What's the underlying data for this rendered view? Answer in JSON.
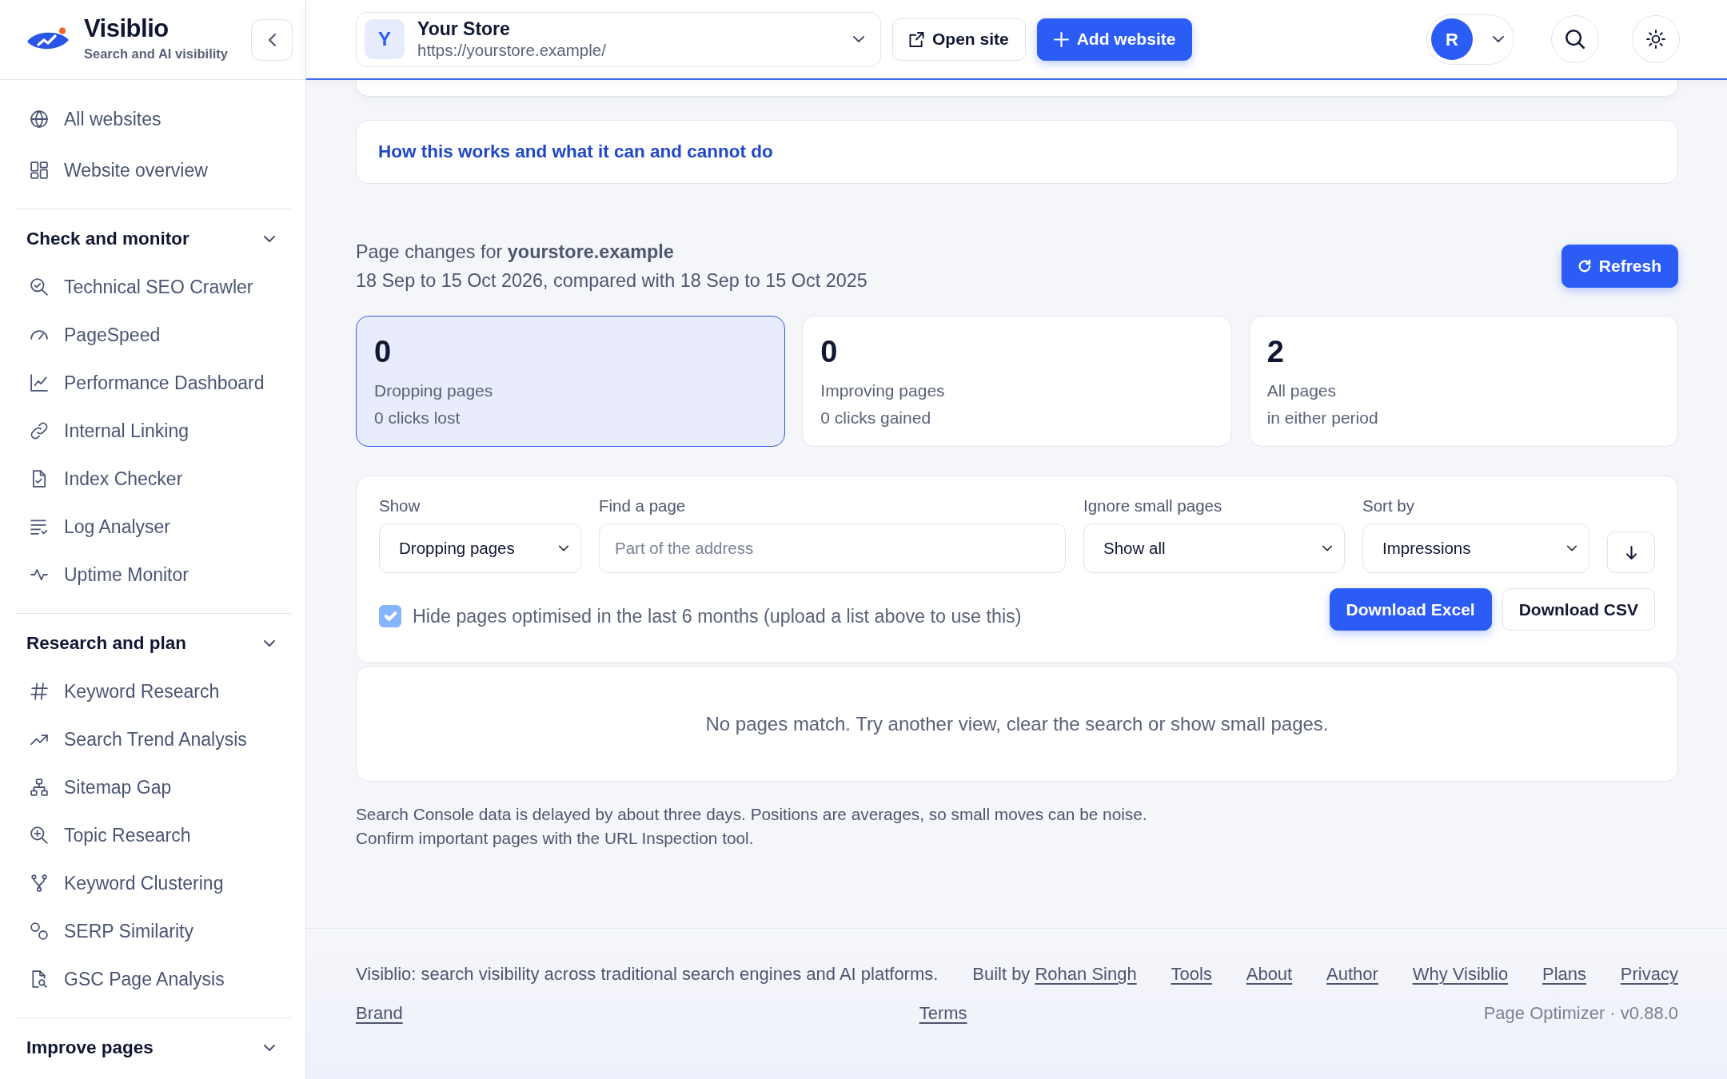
{
  "sidebar": {
    "brand": {
      "name": "Visiblio",
      "tagline": "Search and AI visibility"
    },
    "top_items": [
      {
        "label": "All websites",
        "selected": false
      },
      {
        "label": "Website overview",
        "selected": false
      }
    ],
    "groups": [
      {
        "title": "Check and monitor",
        "expanded": true,
        "items": [
          {
            "label": "Technical SEO Crawler",
            "selected": false
          },
          {
            "label": "PageSpeed",
            "selected": false
          },
          {
            "label": "Performance Dashboard",
            "selected": false
          },
          {
            "label": "Internal Linking",
            "selected": false
          },
          {
            "label": "Index Checker",
            "selected": false
          },
          {
            "label": "Log Analyser",
            "selected": false
          },
          {
            "label": "Uptime Monitor",
            "selected": false
          }
        ]
      },
      {
        "title": "Research and plan",
        "expanded": true,
        "items": [
          {
            "label": "Keyword Research",
            "selected": false
          },
          {
            "label": "Search Trend Analysis",
            "selected": false
          },
          {
            "label": "Sitemap Gap",
            "selected": false
          },
          {
            "label": "Topic Research",
            "selected": false
          },
          {
            "label": "Keyword Clustering",
            "selected": false
          },
          {
            "label": "SERP Similarity",
            "selected": false
          },
          {
            "label": "GSC Page Analysis",
            "selected": false
          }
        ]
      },
      {
        "title": "Improve pages",
        "expanded": true
      }
    ]
  },
  "top_bar": {
    "site": {
      "initial": "Y",
      "name": "Your Store",
      "url": "https://yourstore.example/"
    },
    "buttons": [
      {
        "label": "Open site",
        "kind": "secondary"
      },
      {
        "label": "Add website",
        "kind": "primary"
      }
    ],
    "account": {
      "initial": "R"
    }
  },
  "info": {
    "link": "How this works and what it can and cannot do"
  },
  "report": {
    "title": "Page changes for **yourstore.example**",
    "period": "18 Sep to 15 Oct 2026, compared with 18 Sep to 15 Oct 2025",
    "refresh": "Refresh"
  },
  "stats": [
    {
      "value": "0",
      "label": "Dropping pages",
      "detail": "0 clicks lost",
      "selected": true
    },
    {
      "value": "0",
      "label": "Improving pages",
      "detail": "0 clicks gained",
      "selected": false
    },
    {
      "value": "2",
      "label": "All pages",
      "detail": "in either period",
      "selected": false
    }
  ],
  "filters": {
    "fields": [
      {
        "kind": "select",
        "label": "Show",
        "value": "Dropping pages"
      },
      {
        "kind": "search",
        "label": "Find a page",
        "placeholder": "Part of the address"
      },
      {
        "kind": "select",
        "label": "Ignore small pages",
        "value": "Show all"
      },
      {
        "kind": "select",
        "label": "Sort by",
        "value": "Impressions"
      }
    ],
    "hide_optimised": {
      "label": "Hide pages optimised in the last 6 months (upload a list above to use this)",
      "checked": true,
      "disabled": true
    },
    "downloads": [
      {
        "label": "Download Excel",
        "kind": "primary"
      },
      {
        "label": "Download CSV",
        "kind": "secondary"
      }
    ]
  },
  "results": {
    "empty_message": "No pages match. Try another view, clear the search or show small pages."
  },
  "notes": [
    "Search Console data is delayed by about three days. Positions are averages, so small moves can be noise.",
    "Confirm important pages with the URL Inspection tool."
  ],
  "footer": {
    "tagline": "Visiblio: search visibility across traditional search engines and AI platforms.",
    "credit": {
      "prefix": "Built by",
      "name": "Rohan Singh"
    },
    "links": [
      "Tools",
      "About",
      "Author",
      "Why Visiblio",
      "Plans",
      "Privacy",
      "Brand",
      "Terms"
    ],
    "version": "Page Optimizer · v0.88.0"
  }
}
